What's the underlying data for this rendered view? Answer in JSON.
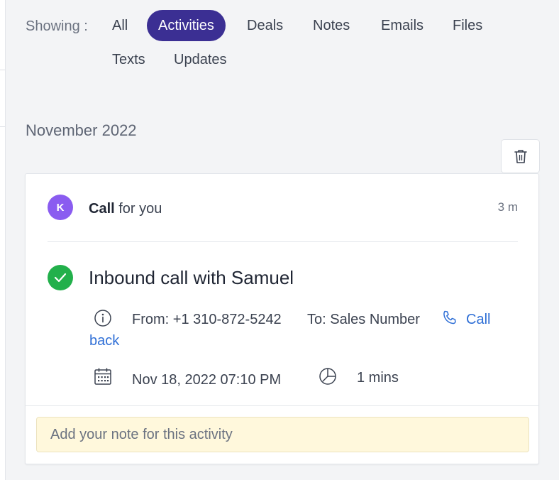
{
  "filters": {
    "label": "Showing :",
    "items": [
      {
        "label": "All",
        "active": false
      },
      {
        "label": "Activities",
        "active": true
      },
      {
        "label": "Deals",
        "active": false
      },
      {
        "label": "Notes",
        "active": false
      },
      {
        "label": "Emails",
        "active": false
      },
      {
        "label": "Files",
        "active": false
      },
      {
        "label": "Texts",
        "active": false
      },
      {
        "label": "Updates",
        "active": false
      }
    ]
  },
  "timeline": {
    "month": "November 2022",
    "activity": {
      "avatar_initial": "K",
      "avatar_color": "#8a5cf0",
      "type": "Call",
      "assignee_text": "for you",
      "elapsed": "3 m",
      "status_color": "#22b04b",
      "title": "Inbound call with Samuel",
      "from": "From: +1 310-872-5242",
      "to": "To: Sales Number",
      "callback_label_1": "Call",
      "callback_label_2": "back",
      "datetime": "Nov 18, 2022 07:10 PM",
      "duration": "1 mins",
      "note_placeholder": "Add your note for this activity"
    }
  },
  "colors": {
    "accent": "#3b2f93",
    "link": "#2f6fd6",
    "note_bg": "#fff8dc"
  },
  "icons": [
    "trash-icon",
    "check-icon",
    "info-icon",
    "phone-icon",
    "calendar-icon",
    "clock-icon"
  ]
}
